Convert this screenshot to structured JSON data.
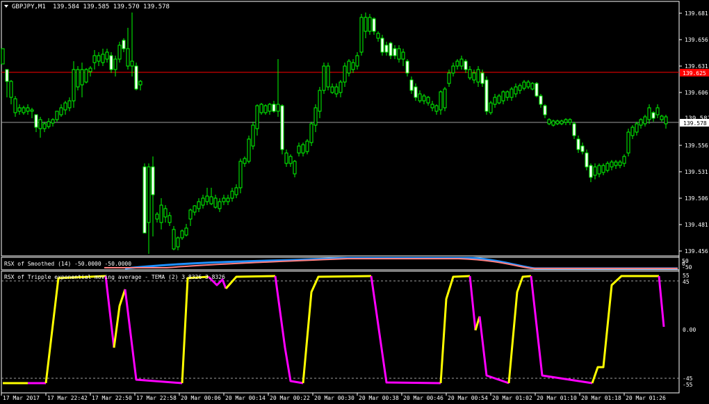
{
  "main_chart": {
    "symbol_label": "GBPJPY,M1",
    "ohlc": "139.584 139.585 139.570 139.578",
    "price_axis": [
      "139.681",
      "139.656",
      "139.631",
      "139.606",
      "139.581",
      "139.556",
      "139.531",
      "139.506",
      "139.481",
      "139.456"
    ],
    "bid_line_label": "139.625",
    "current_price_label": "139.578",
    "hidden_tick_label": "139.581"
  },
  "indicator1": {
    "title": "RSX of Smoothed (14) -50.0000 -50.0000",
    "axis_labels": [
      "50",
      "0",
      "-50"
    ]
  },
  "indicator2": {
    "title": "RSX of Tripple exponential moving average - TEMA (2) 3.8326 3.8326",
    "axis_labels": [
      "55",
      "45",
      "0.00",
      "-45",
      "-55"
    ]
  },
  "time_axis": [
    "17 Mar 2017",
    "17 Mar 22:42",
    "17 Mar 22:50",
    "17 Mar 22:58",
    "20 Mar 00:06",
    "20 Mar 00:14",
    "20 Mar 00:22",
    "20 Mar 00:30",
    "20 Mar 00:38",
    "20 Mar 00:46",
    "20 Mar 00:54",
    "20 Mar 01:02",
    "20 Mar 01:10",
    "20 Mar 01:18",
    "20 Mar 01:26"
  ],
  "colors": {
    "bull_candle": "#00ff00",
    "bear_candle": "#ffffff",
    "bid_line": "#ff0000",
    "tema_up": "#ffff00",
    "tema_down": "#ff00ff",
    "rsx_blue": "#1e90ff",
    "rsx_pink": "#ff8080"
  }
}
